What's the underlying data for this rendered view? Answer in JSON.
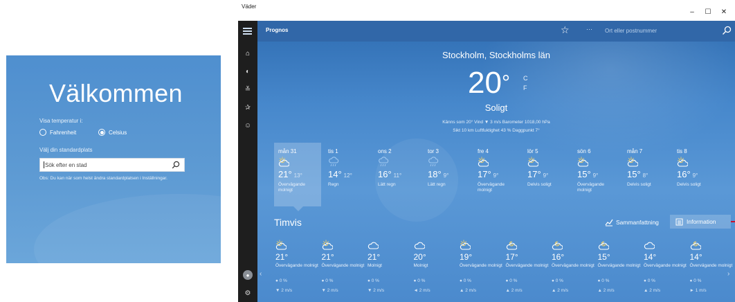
{
  "welcome": {
    "title": "Välkommen",
    "temp_label": "Visa temperatur i:",
    "options": [
      "Fahrenheit",
      "Celsius"
    ],
    "selected": "Celsius",
    "location_label": "Välj din standardplats",
    "search_placeholder": "Sök efter en stad",
    "note": "Obs: Du kan när som helst ändra standardplatsen i Inställningar."
  },
  "window": {
    "title": "Väder",
    "controls": [
      "–",
      "☐",
      "✕"
    ]
  },
  "commandbar": {
    "title": "Prognos",
    "more": "···",
    "search_placeholder": "Ort eller postnummer"
  },
  "current": {
    "location": "Stockholm, Stockholms län",
    "temperature": "20",
    "degree": "°",
    "unit_c": "C",
    "unit_f": "F",
    "condition": "Soligt",
    "details_line1": "Känns som  20°    Vind  ▼ 3 m/s    Barometer  1018,00 hPa",
    "details_line2": "Sikt  10 km    Luftfuktighet  43 %    Daggpunkt  7°"
  },
  "daily": [
    {
      "day": "mån 31",
      "hi": "21°",
      "lo": "13°",
      "desc": "Övervägande molnigt",
      "icon": "partly-sunny"
    },
    {
      "day": "tis 1",
      "hi": "14°",
      "lo": "12°",
      "desc": "Regn",
      "icon": "rain"
    },
    {
      "day": "ons 2",
      "hi": "16°",
      "lo": "11°",
      "desc": "Lätt regn",
      "icon": "rain"
    },
    {
      "day": "tor 3",
      "hi": "18°",
      "lo": "9°",
      "desc": "Lätt regn",
      "icon": "rain"
    },
    {
      "day": "fre 4",
      "hi": "17°",
      "lo": "9°",
      "desc": "Övervägande molnigt",
      "icon": "partly-sunny"
    },
    {
      "day": "lör 5",
      "hi": "17°",
      "lo": "9°",
      "desc": "Delvis soligt",
      "icon": "partly-sunny"
    },
    {
      "day": "sön 6",
      "hi": "15°",
      "lo": "9°",
      "desc": "Övervägande molnigt",
      "icon": "partly-sunny"
    },
    {
      "day": "mån 7",
      "hi": "15°",
      "lo": "8°",
      "desc": "Delvis soligt",
      "icon": "partly-sunny"
    },
    {
      "day": "tis 8",
      "hi": "16°",
      "lo": "9°",
      "desc": "Delvis soligt",
      "icon": "partly-sunny"
    }
  ],
  "hourly_section": {
    "title": "Timvis",
    "summary_label": "Sammanfattning",
    "info_label": "Information"
  },
  "hourly": [
    {
      "temp": "21°",
      "desc": "Övervägande molnigt",
      "precip": "0 %",
      "wind": "▼ 2 m/s",
      "icon": "partly-sunny"
    },
    {
      "temp": "21°",
      "desc": "Övervägande molnigt",
      "precip": "0 %",
      "wind": "▼ 2 m/s",
      "icon": "partly-sunny"
    },
    {
      "temp": "21°",
      "desc": "Molnigt",
      "precip": "0 %",
      "wind": "▼ 2 m/s",
      "icon": "cloudy"
    },
    {
      "temp": "20°",
      "desc": "Molnigt",
      "precip": "0 %",
      "wind": "◄ 2 m/s",
      "icon": "cloudy"
    },
    {
      "temp": "19°",
      "desc": "Övervägande molnigt",
      "precip": "0 %",
      "wind": "▲ 2 m/s",
      "icon": "partly-sunny"
    },
    {
      "temp": "17°",
      "desc": "Övervägande molnigt",
      "precip": "0 %",
      "wind": "▲ 2 m/s",
      "icon": "partly-cloudy-night"
    },
    {
      "temp": "16°",
      "desc": "Övervägande molnigt",
      "precip": "0 %",
      "wind": "▲ 2 m/s",
      "icon": "partly-cloudy-night"
    },
    {
      "temp": "15°",
      "desc": "Övervägande molnigt",
      "precip": "0 %",
      "wind": "▲ 2 m/s",
      "icon": "partly-cloudy-night"
    },
    {
      "temp": "14°",
      "desc": "Övervägande molnigt",
      "precip": "0 %",
      "wind": "▲ 2 m/s",
      "icon": "cloudy"
    },
    {
      "temp": "14°",
      "desc": "Övervägande molnigt",
      "precip": "0 %",
      "wind": "► 1 m/s",
      "icon": "partly-cloudy-night"
    }
  ],
  "colors": {
    "accent_red": "#c8102e",
    "sky_blue": "#4788cc",
    "rail": "#1e1e1e"
  }
}
